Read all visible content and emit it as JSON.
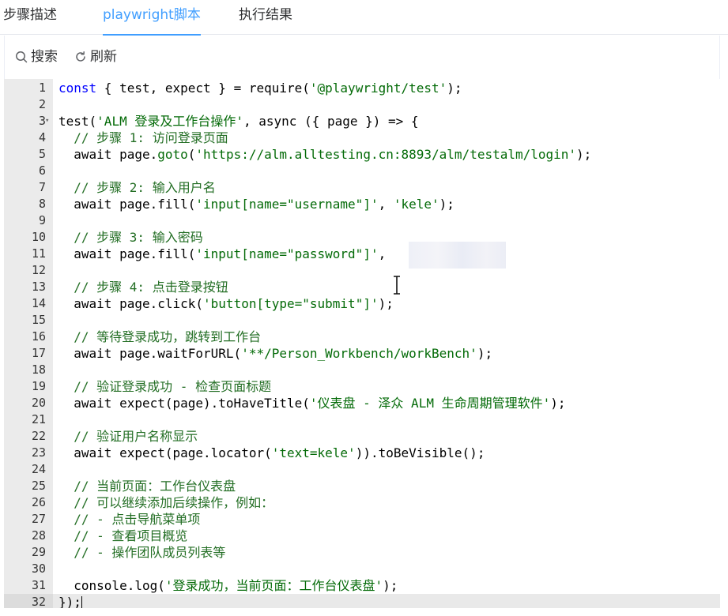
{
  "tabs": [
    {
      "label": "步骤描述",
      "active": false
    },
    {
      "label": "playwright脚本",
      "active": true
    },
    {
      "label": "执行结果",
      "active": false
    }
  ],
  "toolbar": {
    "search_label": "搜索",
    "refresh_label": "刷新"
  },
  "editor": {
    "active_line": 32,
    "lines": [
      {
        "n": "1",
        "tokens": [
          [
            "kw",
            "const"
          ],
          [
            "p",
            " { test, expect } = require("
          ],
          [
            "str",
            "'@playwright/test'"
          ],
          [
            "p",
            ");"
          ]
        ]
      },
      {
        "n": "2",
        "tokens": []
      },
      {
        "n": "3",
        "fold": true,
        "tokens": [
          [
            "p",
            "test("
          ],
          [
            "str",
            "'ALM 登录及工作台操作'"
          ],
          [
            "p",
            ", async ({ page }) => {"
          ]
        ]
      },
      {
        "n": "4",
        "tokens": [
          [
            "cm",
            "  // 步骤 1: 访问登录页面"
          ]
        ]
      },
      {
        "n": "5",
        "tokens": [
          [
            "p",
            "  await page."
          ],
          [
            "str",
            "goto"
          ],
          [
            "p",
            "("
          ],
          [
            "str",
            "'https://alm.alltesting.cn:8893/alm/testalm/login'"
          ],
          [
            "p",
            ");"
          ]
        ]
      },
      {
        "n": "6",
        "tokens": []
      },
      {
        "n": "7",
        "tokens": [
          [
            "cm",
            "  // 步骤 2: 输入用户名"
          ]
        ]
      },
      {
        "n": "8",
        "tokens": [
          [
            "p",
            "  await page.fill("
          ],
          [
            "str",
            "'input[name=\"username\"]'"
          ],
          [
            "p",
            ", "
          ],
          [
            "str",
            "'kele'"
          ],
          [
            "p",
            ");"
          ]
        ]
      },
      {
        "n": "9",
        "tokens": []
      },
      {
        "n": "10",
        "tokens": [
          [
            "cm",
            "  // 步骤 3: 输入密码"
          ]
        ]
      },
      {
        "n": "11",
        "tokens": [
          [
            "p",
            "  await page.fill("
          ],
          [
            "str",
            "'input[name=\"password\"]'"
          ],
          [
            "p",
            ",              );"
          ]
        ]
      },
      {
        "n": "12",
        "tokens": []
      },
      {
        "n": "13",
        "tokens": [
          [
            "cm",
            "  // 步骤 4: 点击登录按钮"
          ]
        ]
      },
      {
        "n": "14",
        "tokens": [
          [
            "p",
            "  await page.click("
          ],
          [
            "str",
            "'button[type=\"submit\"]'"
          ],
          [
            "p",
            ");"
          ]
        ]
      },
      {
        "n": "15",
        "tokens": []
      },
      {
        "n": "16",
        "tokens": [
          [
            "cm",
            "  // 等待登录成功，跳转到工作台"
          ]
        ]
      },
      {
        "n": "17",
        "tokens": [
          [
            "p",
            "  await page.waitForURL("
          ],
          [
            "str",
            "'**/Person_Workbench/workBench'"
          ],
          [
            "p",
            ");"
          ]
        ]
      },
      {
        "n": "18",
        "tokens": []
      },
      {
        "n": "19",
        "tokens": [
          [
            "cm",
            "  // 验证登录成功 - 检查页面标题"
          ]
        ]
      },
      {
        "n": "20",
        "tokens": [
          [
            "p",
            "  await expect(page).toHaveTitle("
          ],
          [
            "str",
            "'仪表盘 - 泽众 ALM 生命周期管理软件'"
          ],
          [
            "p",
            ");"
          ]
        ]
      },
      {
        "n": "21",
        "tokens": []
      },
      {
        "n": "22",
        "tokens": [
          [
            "cm",
            "  // 验证用户名称显示"
          ]
        ]
      },
      {
        "n": "23",
        "tokens": [
          [
            "p",
            "  await expect(page.locator("
          ],
          [
            "str",
            "'text=kele'"
          ],
          [
            "p",
            ")).toBeVisible();"
          ]
        ]
      },
      {
        "n": "24",
        "tokens": []
      },
      {
        "n": "25",
        "tokens": [
          [
            "cm",
            "  // 当前页面：工作台仪表盘"
          ]
        ]
      },
      {
        "n": "26",
        "tokens": [
          [
            "cm",
            "  // 可以继续添加后续操作，例如："
          ]
        ]
      },
      {
        "n": "27",
        "tokens": [
          [
            "cm",
            "  // - 点击导航菜单项"
          ]
        ]
      },
      {
        "n": "28",
        "tokens": [
          [
            "cm",
            "  // - 查看项目概览"
          ]
        ]
      },
      {
        "n": "29",
        "tokens": [
          [
            "cm",
            "  // - 操作团队成员列表等"
          ]
        ]
      },
      {
        "n": "30",
        "tokens": []
      },
      {
        "n": "31",
        "tokens": [
          [
            "p",
            "  console.log("
          ],
          [
            "str",
            "'登录成功，当前页面：工作台仪表盘'"
          ],
          [
            "p",
            ");"
          ]
        ]
      },
      {
        "n": "32",
        "tokens": [
          [
            "p",
            "});"
          ]
        ]
      }
    ]
  }
}
